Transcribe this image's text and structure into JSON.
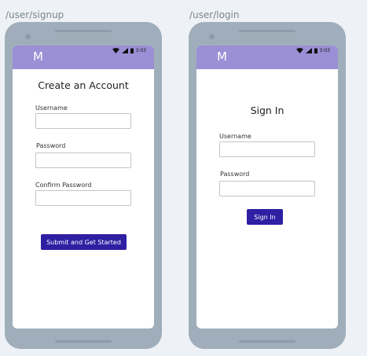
{
  "signup": {
    "route": "/user/signup",
    "logo": "M",
    "time": "3:03",
    "title": "Create an Account",
    "username_label": "Username",
    "password_label": "Password",
    "confirm_label": "Confirm Password",
    "username_value": "",
    "password_value": "",
    "confirm_value": "",
    "submit_label": "Submit and Get Started"
  },
  "login": {
    "route": "/user/login",
    "logo": "M",
    "time": "3:03",
    "title": "Sign In",
    "username_label": "Username",
    "password_label": "Password",
    "username_value": "",
    "password_value": "",
    "submit_label": "Sign In"
  },
  "icons": {
    "wifi": "wifi-icon",
    "signal": "signal-icon",
    "battery": "battery-icon"
  },
  "colors": {
    "appbar": "#9b8fd6",
    "button": "#2e1fa3",
    "device": "#a0aebb"
  }
}
